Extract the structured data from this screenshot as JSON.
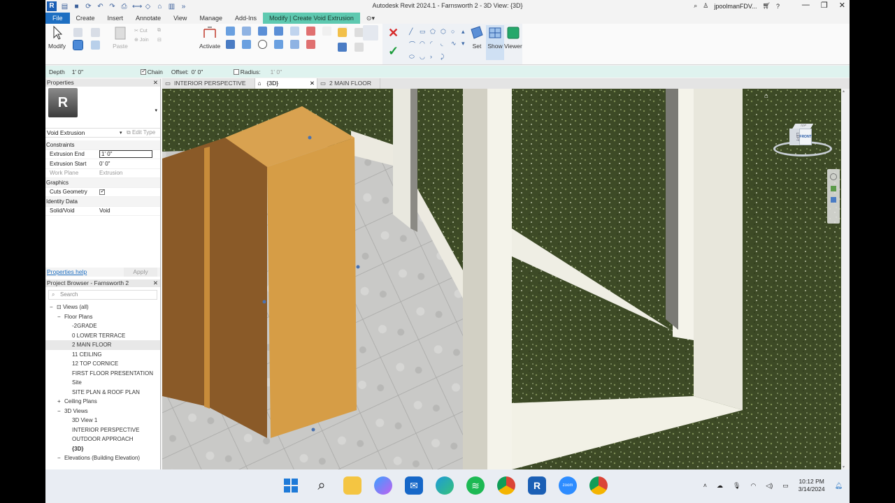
{
  "window": {
    "title": "Autodesk Revit 2024.1 - Farnsworth 2 - 3D View: {3D}",
    "user": "jpoolmanFDV...",
    "app_logo": "R"
  },
  "menu": {
    "file": "File",
    "items": [
      "Create",
      "Insert",
      "Annotate",
      "View",
      "Manage",
      "Add-Ins"
    ],
    "context_tab": "Modify | Create Void Extrusion"
  },
  "ribbon": {
    "modify_label": "Modify",
    "paste_label": "Paste",
    "cut_label": "Cut",
    "join_label": "Join",
    "activate_label": "Activate",
    "set_label": "Set",
    "show_label": "Show",
    "viewer_label": "Viewer"
  },
  "options_bar": {
    "depth_label": "Depth",
    "depth_value": "1'  0\"",
    "chain_label": "Chain",
    "offset_label": "Offset:",
    "offset_value": "0'  0\"",
    "radius_label": "Radius:",
    "radius_value": "1'  0\""
  },
  "properties": {
    "title": "Properties",
    "type_icon": "R",
    "type_name": "Void Extrusion",
    "edit_type": "Edit Type",
    "sections": [
      {
        "category": "Constraints"
      },
      {
        "key": "Extrusion End",
        "value": "1'  0\"",
        "editing": true
      },
      {
        "key": "Extrusion Start",
        "value": "0'  0\""
      },
      {
        "key": "Work Plane",
        "value": "Extrusion",
        "disabled": true
      },
      {
        "category": "Graphics"
      },
      {
        "key": "Cuts Geometry",
        "checkbox": true
      },
      {
        "category": "Identity Data"
      },
      {
        "key": "Solid/Void",
        "value": "Void"
      }
    ],
    "help_link": "Properties help",
    "apply_label": "Apply"
  },
  "project_browser": {
    "title": "Project Browser - Farnsworth 2",
    "search_placeholder": "Search",
    "tree": [
      {
        "label": "Views (all)",
        "level": 0,
        "toggle": "−"
      },
      {
        "label": "Floor Plans",
        "level": 1,
        "toggle": "−"
      },
      {
        "label": "-2GRADE",
        "level": 2
      },
      {
        "label": "0 LOWER TERRACE",
        "level": 2
      },
      {
        "label": "2 MAIN FLOOR",
        "level": 2,
        "selected": true
      },
      {
        "label": "11 CEILING",
        "level": 2
      },
      {
        "label": "12 TOP CORNICE",
        "level": 2
      },
      {
        "label": "FIRST FLOOR PRESENTATION",
        "level": 2
      },
      {
        "label": "Site",
        "level": 2
      },
      {
        "label": "SITE PLAN & ROOF PLAN",
        "level": 2
      },
      {
        "label": "Ceiling Plans",
        "level": 1,
        "toggle": "+"
      },
      {
        "label": "3D Views",
        "level": 1,
        "toggle": "−"
      },
      {
        "label": "3D View 1",
        "level": 2
      },
      {
        "label": "INTERIOR PERSPECTIVE",
        "level": 2
      },
      {
        "label": "OUTDOOR APPROACH",
        "level": 2
      },
      {
        "label": "{3D}",
        "level": 2,
        "bold": true
      },
      {
        "label": "Elevations (Building Elevation)",
        "level": 1,
        "toggle": "−"
      }
    ]
  },
  "view_tabs": [
    {
      "label": "INTERIOR PERSPECTIVE",
      "active": false
    },
    {
      "label": "{3D}",
      "active": true
    },
    {
      "label": "2 MAIN FLOOR",
      "active": false
    }
  ],
  "viewcube": {
    "face_front": "FRONT",
    "face_left": "LEFT",
    "face_top": "TOP"
  },
  "taskbar": {
    "time": "10:12 PM",
    "date": "3/14/2024",
    "apps": [
      "windows-start",
      "search",
      "file-explorer",
      "copilot",
      "mail",
      "edge",
      "spotify",
      "chrome",
      "revit",
      "zoom",
      "chrome-profile"
    ]
  },
  "colors": {
    "file_tab": "#1e6fc2",
    "context_tab": "#5ec9b0",
    "options_bar": "#dff3ef",
    "extrusion_front": "#d69d46",
    "extrusion_side": "#8a5a28"
  }
}
